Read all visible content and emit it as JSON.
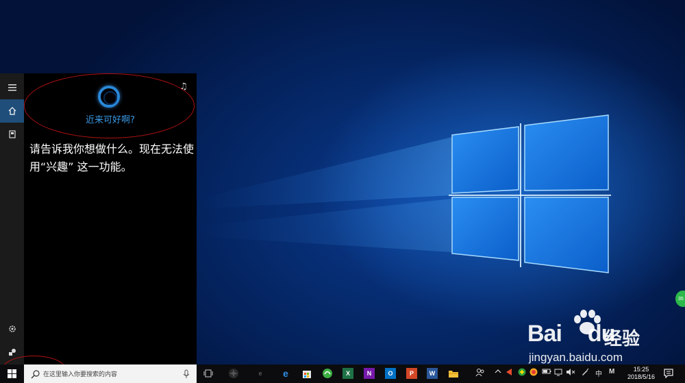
{
  "cortana": {
    "greeting": "近来可好啊?",
    "message": "请告诉我你想做什么。现在无法使用“兴趣” 这一功能。",
    "rail": {
      "menu_icon": "hamburger-icon",
      "home_icon": "home-icon",
      "notebook_icon": "notebook-icon",
      "settings_icon": "gear-icon",
      "feedback_icon": "feedback-icon"
    },
    "music_icon": "music-note-icon"
  },
  "taskbar": {
    "search_placeholder": "在这里输入你要搜索的内容",
    "apps": [
      {
        "name": "task-view",
        "label": ""
      },
      {
        "name": "app-generic",
        "label": ""
      },
      {
        "name": "internet-explorer",
        "label": "e"
      },
      {
        "name": "edge",
        "label": "e"
      },
      {
        "name": "store",
        "label": ""
      },
      {
        "name": "360-browser",
        "label": ""
      },
      {
        "name": "excel",
        "label": "X"
      },
      {
        "name": "onenote",
        "label": "N"
      },
      {
        "name": "outlook",
        "label": "O"
      },
      {
        "name": "powerpoint",
        "label": "P"
      },
      {
        "name": "word",
        "label": "W"
      },
      {
        "name": "file-explorer",
        "label": ""
      }
    ],
    "tray": {
      "ime_label": "中",
      "ime_mode": "M"
    },
    "clock": {
      "time": "15:25",
      "date": "2018/5/16"
    }
  },
  "watermark": {
    "brand": "Bai",
    "brand2": "du",
    "jingyan": "经验",
    "url": "jingyan.baidu.com"
  },
  "side_badge": "35",
  "colors": {
    "accent": "#2a88d8",
    "greeting": "#3a9be8",
    "rail_active": "#1f4e7a",
    "annotation": "#b01212"
  }
}
